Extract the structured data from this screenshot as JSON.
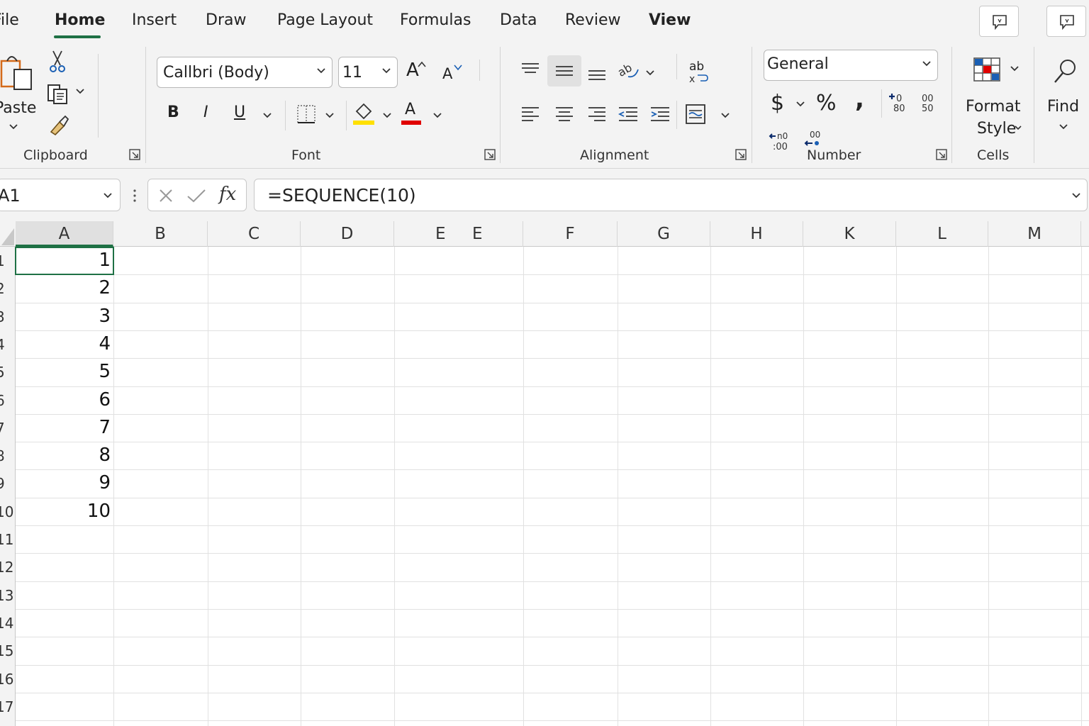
{
  "tabs": [
    {
      "label": "File"
    },
    {
      "label": "Home",
      "active": true
    },
    {
      "label": "Insert"
    },
    {
      "label": "Draw"
    },
    {
      "label": "Page Layout"
    },
    {
      "label": "Formulas"
    },
    {
      "label": "Data"
    },
    {
      "label": "Review"
    },
    {
      "label": "View"
    }
  ],
  "ribbon": {
    "clipboard": {
      "paste_label": "Paste",
      "group_label": "Clipboard"
    },
    "font": {
      "font_name": "Callbri (Body)",
      "font_size": "11",
      "bold": "B",
      "italic": "I",
      "underline": "U",
      "grow": "A",
      "shrink": "A",
      "font_color_glyph": "A",
      "group_label": "Font"
    },
    "alignment": {
      "wrap_glyph": "ab",
      "group_label": "Alignment"
    },
    "number": {
      "format": "General",
      "currency": "$",
      "percent": "%",
      "comma": ",",
      "group_label": "Number"
    },
    "cells": {
      "format_label": "Format",
      "style_label": "Style",
      "group_label": "Cells"
    },
    "editing": {
      "find_label": "Find"
    }
  },
  "formula_bar": {
    "name_box": "A1",
    "formula": "=SEQUENCE(10)",
    "fx": "fx"
  },
  "columns": [
    "A",
    "B",
    "C",
    "D",
    "E",
    "E",
    "F",
    "G",
    "H",
    "K",
    "L",
    "M"
  ],
  "rows": [
    "1",
    "2",
    "3",
    "4",
    "5",
    "6",
    "7",
    "8",
    "9",
    "10",
    "11",
    "12",
    "13",
    "14",
    "15",
    "16",
    "17"
  ],
  "cells_A": [
    "1",
    "2",
    "3",
    "4",
    "5",
    "6",
    "7",
    "8",
    "9",
    "10"
  ],
  "colors": {
    "accent": "#1f7145",
    "highlight": "#ffe000",
    "font_color": "#e00000"
  }
}
